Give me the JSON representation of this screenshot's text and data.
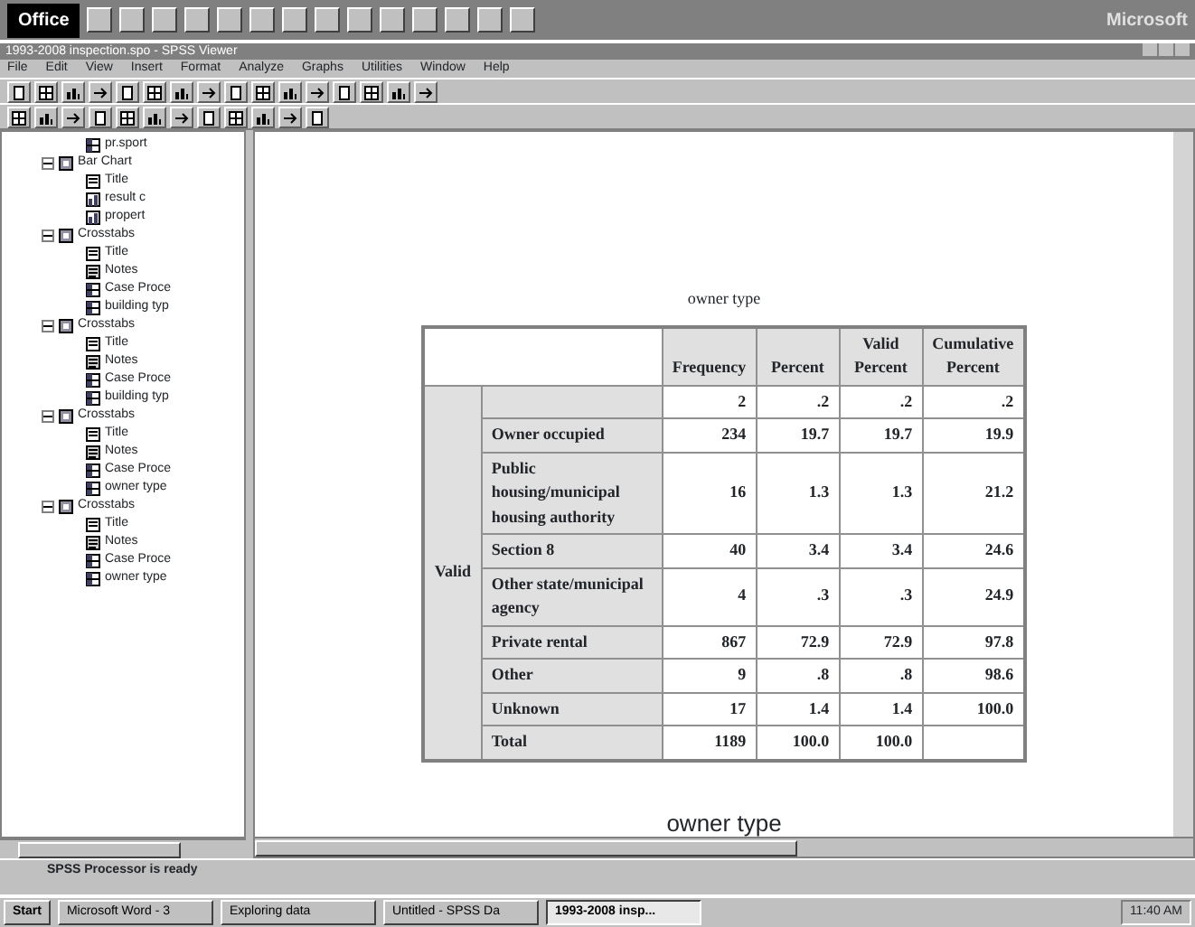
{
  "office_bar": {
    "label": "Office",
    "brand": "Microsoft"
  },
  "window": {
    "title": "1993-2008 inspection.spo - SPSS Viewer"
  },
  "menu": [
    "File",
    "Edit",
    "View",
    "Insert",
    "Format",
    "Analyze",
    "Graphs",
    "Utilities",
    "Window",
    "Help"
  ],
  "outline": [
    {
      "label": "pr.sport",
      "kind": "table"
    },
    {
      "label": "Bar Chart",
      "kind": "folder",
      "expanded": true,
      "children": [
        {
          "label": "Title",
          "kind": "title"
        },
        {
          "label": "result c",
          "kind": "chart"
        },
        {
          "label": "propert",
          "kind": "chart"
        }
      ]
    },
    {
      "label": "Crosstabs",
      "kind": "folder",
      "expanded": true,
      "children": [
        {
          "label": "Title",
          "kind": "title"
        },
        {
          "label": "Notes",
          "kind": "notes"
        },
        {
          "label": "Case Proce",
          "kind": "table"
        },
        {
          "label": "building typ",
          "kind": "table"
        }
      ]
    },
    {
      "label": "Crosstabs",
      "kind": "folder",
      "expanded": true,
      "children": [
        {
          "label": "Title",
          "kind": "title"
        },
        {
          "label": "Notes",
          "kind": "notes"
        },
        {
          "label": "Case Proce",
          "kind": "table"
        },
        {
          "label": "building typ",
          "kind": "table"
        }
      ]
    },
    {
      "label": "Crosstabs",
      "kind": "folder",
      "expanded": true,
      "children": [
        {
          "label": "Title",
          "kind": "title"
        },
        {
          "label": "Notes",
          "kind": "notes"
        },
        {
          "label": "Case Proce",
          "kind": "table"
        },
        {
          "label": "owner type",
          "kind": "table"
        }
      ]
    },
    {
      "label": "Crosstabs",
      "kind": "folder",
      "expanded": true,
      "children": [
        {
          "label": "Title",
          "kind": "title"
        },
        {
          "label": "Notes",
          "kind": "notes"
        },
        {
          "label": "Case Proce",
          "kind": "table"
        },
        {
          "label": "owner type",
          "kind": "table"
        }
      ]
    }
  ],
  "output": {
    "title": "owner type",
    "columns": [
      "Frequency",
      "Percent",
      "Valid Percent",
      "Cumulative Percent"
    ],
    "group": "Valid",
    "rows": [
      {
        "label": "",
        "values": [
          "2",
          ".2",
          ".2",
          ".2"
        ]
      },
      {
        "label": "Owner occupied",
        "values": [
          "234",
          "19.7",
          "19.7",
          "19.9"
        ]
      },
      {
        "label": "Public housing/municipal housing authority",
        "values": [
          "16",
          "1.3",
          "1.3",
          "21.2"
        ]
      },
      {
        "label": "Section 8",
        "values": [
          "40",
          "3.4",
          "3.4",
          "24.6"
        ]
      },
      {
        "label": "Other state/municipal agency",
        "values": [
          "4",
          ".3",
          ".3",
          "24.9"
        ]
      },
      {
        "label": "Private rental",
        "values": [
          "867",
          "72.9",
          "72.9",
          "97.8"
        ]
      },
      {
        "label": "Other",
        "values": [
          "9",
          ".8",
          ".8",
          "98.6"
        ]
      },
      {
        "label": "Unknown",
        "values": [
          "17",
          "1.4",
          "1.4",
          "100.0"
        ]
      },
      {
        "label": "Total",
        "values": [
          "1189",
          "100.0",
          "100.0"
        ]
      }
    ],
    "chart_title": "owner type"
  },
  "status_bar": "SPSS Processor is ready",
  "taskbar": {
    "start": "Start",
    "tasks": [
      {
        "label": "Microsoft Word - 3",
        "selected": false
      },
      {
        "label": "Exploring data",
        "selected": false
      },
      {
        "label": "Untitled - SPSS Da",
        "selected": false
      },
      {
        "label": "1993-2008 insp...",
        "selected": true
      }
    ],
    "clock": "11:40 AM"
  }
}
